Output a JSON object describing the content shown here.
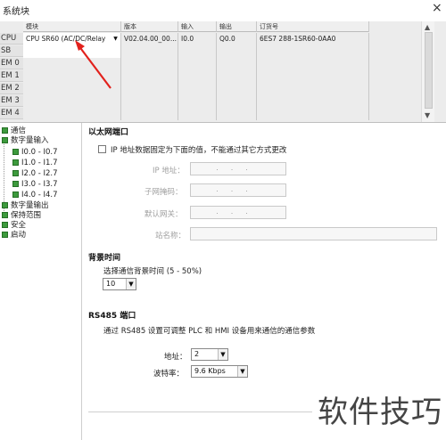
{
  "window": {
    "title": "系统块",
    "close_label": "×"
  },
  "grid": {
    "columns": [
      "模块",
      "版本",
      "输入",
      "输出",
      "订货号"
    ],
    "rows": [
      {
        "label": "CPU",
        "module": "CPU SR60 (AC/DC/Relay",
        "version": "V02.04.00_00...",
        "input": "I0.0",
        "output": "Q0.0",
        "order": "6ES7 288-1SR60-0AA0"
      },
      {
        "label": "SB",
        "module": "",
        "version": "",
        "input": "",
        "output": "",
        "order": ""
      },
      {
        "label": "EM 0",
        "module": "",
        "version": "",
        "input": "",
        "output": "",
        "order": ""
      },
      {
        "label": "EM 1",
        "module": "",
        "version": "",
        "input": "",
        "output": "",
        "order": ""
      },
      {
        "label": "EM 2",
        "module": "",
        "version": "",
        "input": "",
        "output": "",
        "order": ""
      },
      {
        "label": "EM 3",
        "module": "",
        "version": "",
        "input": "",
        "output": "",
        "order": ""
      },
      {
        "label": "EM 4",
        "module": "",
        "version": "",
        "input": "",
        "output": "",
        "order": ""
      }
    ]
  },
  "tree": {
    "items": [
      {
        "label": "通信",
        "level": 0
      },
      {
        "label": "数字量输入",
        "level": 0
      },
      {
        "label": "I0.0 - I0.7",
        "level": 1
      },
      {
        "label": "I1.0 - I1.7",
        "level": 1
      },
      {
        "label": "I2.0 - I2.7",
        "level": 1
      },
      {
        "label": "I3.0 - I3.7",
        "level": 1
      },
      {
        "label": "I4.0 - I4.7",
        "level": 1
      },
      {
        "label": "数字量输出",
        "level": 0
      },
      {
        "label": "保持范围",
        "level": 0
      },
      {
        "label": "安全",
        "level": 0
      },
      {
        "label": "启动",
        "level": 0
      }
    ]
  },
  "ethernet": {
    "title": "以太网端口",
    "fixed_ip_checkbox_label": "IP 地址数据固定为下面的值，不能通过其它方式更改",
    "fixed_ip_checked": false,
    "ip_label": "IP 地址：",
    "subnet_label": "子网掩码：",
    "gateway_label": "默认网关：",
    "station_label": "站名称：",
    "ip_dots": "...",
    "station_value": ""
  },
  "background": {
    "title": "背景时间",
    "desc": "选择通信背景时间 (5 - 50%)",
    "value": "10"
  },
  "rs485": {
    "title": "RS485 端口",
    "desc": "通过 RS485 设置可调整 PLC 和 HMI 设备用来通信的通信参数",
    "address_label": "地址：",
    "address_value": "2",
    "baud_label": "波特率：",
    "baud_value": "9.6 Kbps"
  },
  "watermark": {
    "text": "软件技巧"
  },
  "colors": {
    "tree_icon": "#3d9a3d",
    "arrow": "#e2211c"
  }
}
